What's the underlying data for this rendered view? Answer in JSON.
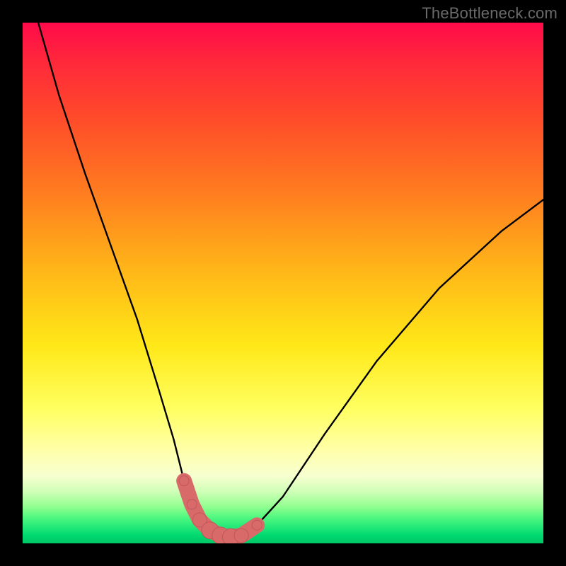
{
  "watermark": "TheBottleneck.com",
  "colors": {
    "background": "#000000",
    "curve": "#000000",
    "marker_fill": "#d86a6a",
    "marker_stroke": "#c05858",
    "gradient_top": "#ff0a4a",
    "gradient_bottom": "#00c868"
  },
  "chart_data": {
    "type": "line",
    "title": "",
    "xlabel": "",
    "ylabel": "",
    "xlim": [
      0,
      100
    ],
    "ylim": [
      0,
      100
    ],
    "grid": false,
    "legend_position": "none",
    "series": [
      {
        "name": "bottleneck-curve",
        "x": [
          3,
          7,
          12,
          17,
          22,
          26,
          29,
          31,
          32.5,
          34,
          36,
          38,
          40,
          42,
          45,
          50,
          58,
          68,
          80,
          92,
          100
        ],
        "values": [
          100,
          86,
          71,
          57,
          43,
          30,
          20,
          12,
          7.5,
          4.5,
          2.5,
          1.5,
          1.2,
          1.5,
          3.5,
          9,
          21,
          35,
          49,
          60,
          66
        ]
      }
    ],
    "markers": {
      "name": "highlight-points",
      "x": [
        31,
        32.5,
        34,
        36,
        38,
        40,
        42,
        45
      ],
      "values": [
        12,
        7.5,
        4.5,
        2.5,
        1.5,
        1.2,
        1.5,
        3.5
      ],
      "radius": [
        7,
        7,
        10,
        12,
        12,
        12,
        10,
        7
      ]
    }
  }
}
